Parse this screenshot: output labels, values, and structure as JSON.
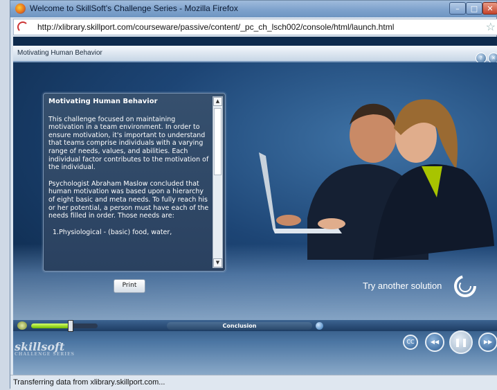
{
  "window": {
    "title": "Welcome to SkillSoft's Challenge Series - Mozilla Firefox",
    "url": "http://xlibrary.skillport.com/courseware/passive/content/_pc_ch_lsch002/console/html/launch.html"
  },
  "course": {
    "header_title": "Motivating Human Behavior"
  },
  "panel": {
    "title": "Motivating Human Behavior",
    "paragraphs": [
      "This challenge focused on maintaining motivation in a team environment. In order to ensure motivation, it's important to understand that teams comprise individuals with a varying range of needs, values, and abilities. Each individual factor contributes to the motivation of the individual.",
      "Psychologist Abraham Maslow concluded that human motivation was based upon a hierarchy of eight basic and meta needs. To fully reach his or her potential, a person must have each of the needs filled in order.  Those needs are:",
      "1.Physiological - (basic) food, water,"
    ],
    "print_label": "Print"
  },
  "scene": {
    "try_label": "Try another solution"
  },
  "controls": {
    "section_label": "Conclusion",
    "volume_level": 0.58,
    "cc_label": "CC",
    "back_label": "◀◀",
    "pause_label": "❚❚",
    "forward_label": "▶▶"
  },
  "logo": {
    "brand": "skillsoft",
    "series": "CHALLENGE SERIES"
  },
  "status": {
    "text": "Transferring data from xlibrary.skillport.com..."
  },
  "colors": {
    "accent_green": "#7ed000",
    "panel_bg": "#2f4868"
  }
}
